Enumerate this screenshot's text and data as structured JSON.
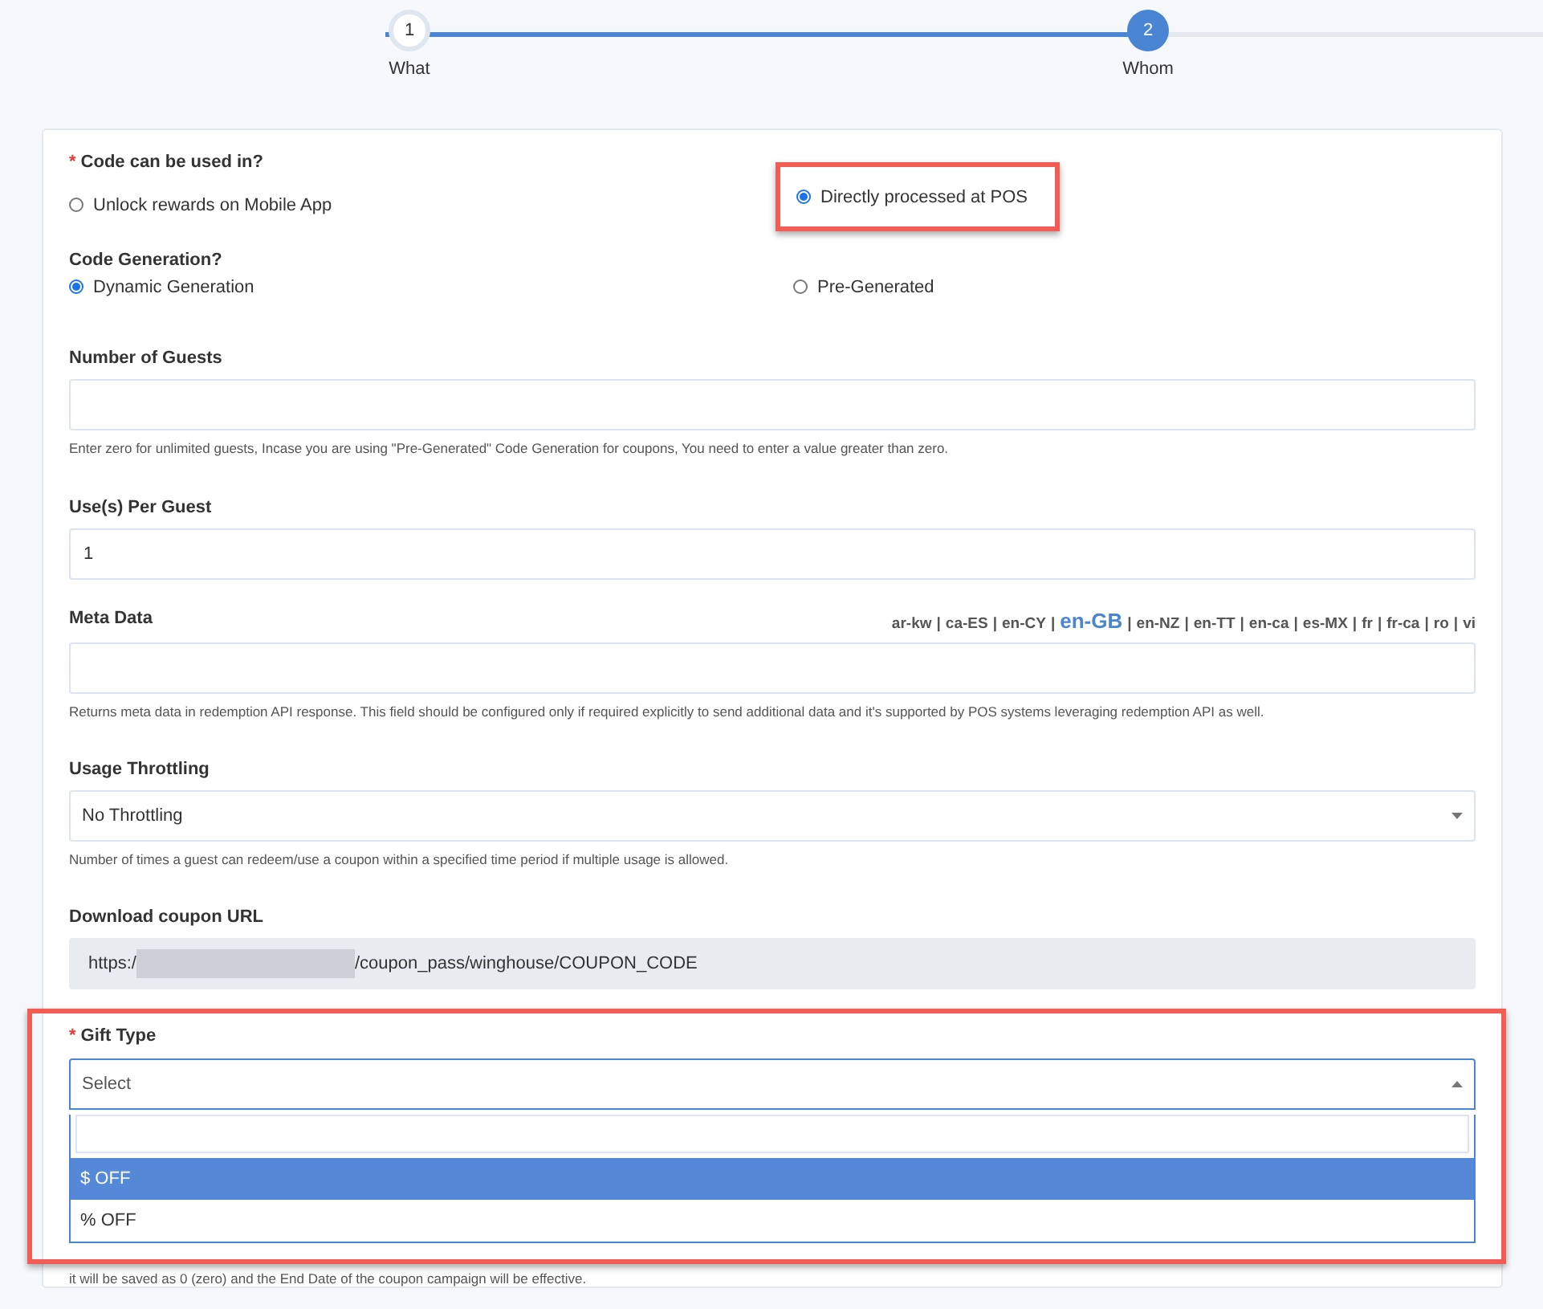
{
  "stepper": {
    "level": 0.66,
    "steps": [
      {
        "number": "1",
        "label": "What",
        "selected": false
      },
      {
        "number": "2",
        "label": "Whom",
        "selected": true
      }
    ]
  },
  "code_used_in": {
    "label": "Code can be used in?",
    "required_mark": "*",
    "highlighted": true,
    "options": [
      {
        "label": "Unlock rewards on Mobile App",
        "selected": false
      },
      {
        "label": "Directly processed at POS",
        "selected": true
      }
    ]
  },
  "code_generation": {
    "label": "Code Generation?",
    "options": [
      {
        "label": "Dynamic Generation",
        "selected": true
      },
      {
        "label": "Pre-Generated",
        "selected": false
      }
    ]
  },
  "number_of_guests": {
    "label": "Number of Guests",
    "help": "Enter zero for unlimited guests, Incase you are using \"Pre-Generated\" Code Generation for coupons, You need to enter a value greater than zero."
  },
  "uses_per_guest": {
    "label": "Use(s) Per Guest",
    "value": "1"
  },
  "meta_data": {
    "label": "Meta Data",
    "languages": [
      {
        "code": "ar-kw",
        "selected": false
      },
      {
        "code": "ca-ES",
        "selected": false
      },
      {
        "code": "en-CY",
        "selected": false
      },
      {
        "code": "en-GB",
        "selected": true
      },
      {
        "code": "en-NZ",
        "selected": false
      },
      {
        "code": "en-TT",
        "selected": false
      },
      {
        "code": "en-ca",
        "selected": false
      },
      {
        "code": "es-MX",
        "selected": false
      },
      {
        "code": "fr",
        "selected": false
      },
      {
        "code": "fr-ca",
        "selected": false
      },
      {
        "code": "ro",
        "selected": false
      },
      {
        "code": "vi",
        "selected": false
      }
    ],
    "separator": "|",
    "help": "Returns meta data in redemption API response. This field should be configured only if required explicitly to send additional data and it's supported by POS systems leveraging redemption API as well."
  },
  "usage_throttling": {
    "label": "Usage Throttling",
    "value": "No Throttling",
    "help": "Number of times a guest can redeem/use a coupon within a specified time period if multiple usage is allowed."
  },
  "download_url": {
    "label": "Download coupon URL",
    "prefix": "https:/",
    "suffix": "/coupon_pass/winghouse/COUPON_CODE"
  },
  "gift_type": {
    "label": "Gift Type",
    "required_mark": "*",
    "highlighted": true,
    "placeholder": "Select",
    "expanded": true,
    "options": [
      {
        "label": "$ OFF",
        "selected": true
      },
      {
        "label": "% OFF",
        "selected": false
      }
    ]
  },
  "trailing_help": "it will be saved as 0 (zero) and the End Date of the coupon campaign will be effective."
}
